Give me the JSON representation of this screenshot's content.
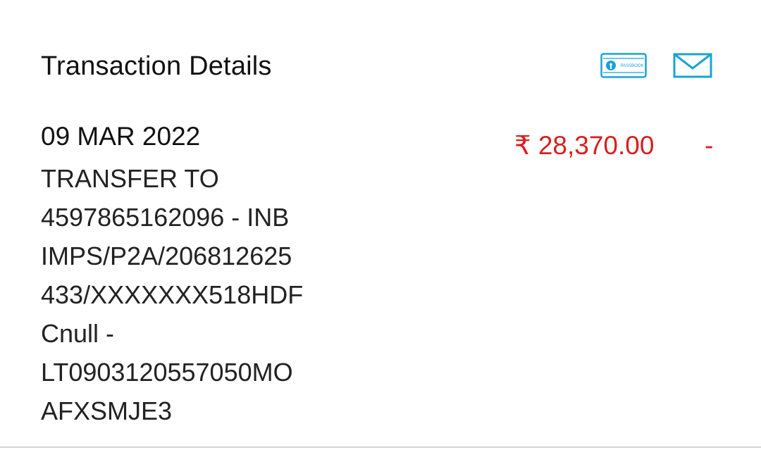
{
  "header": {
    "title": "Transaction Details",
    "passbook_icon_label": "PASSBOOK",
    "icon_color": "#1aa3d6"
  },
  "transaction": {
    "date": "09 MAR 2022",
    "description_lines": [
      "TRANSFER TO",
      "4597865162096 - INB",
      "IMPS/P2A/206812625",
      "433/XXXXXXX518HDF",
      "Cnull -",
      "LT0903120557050MO",
      "AFXSMJE3"
    ],
    "amount": "₹ 28,370.00",
    "balance": "-",
    "amount_color": "#d81f1f"
  }
}
